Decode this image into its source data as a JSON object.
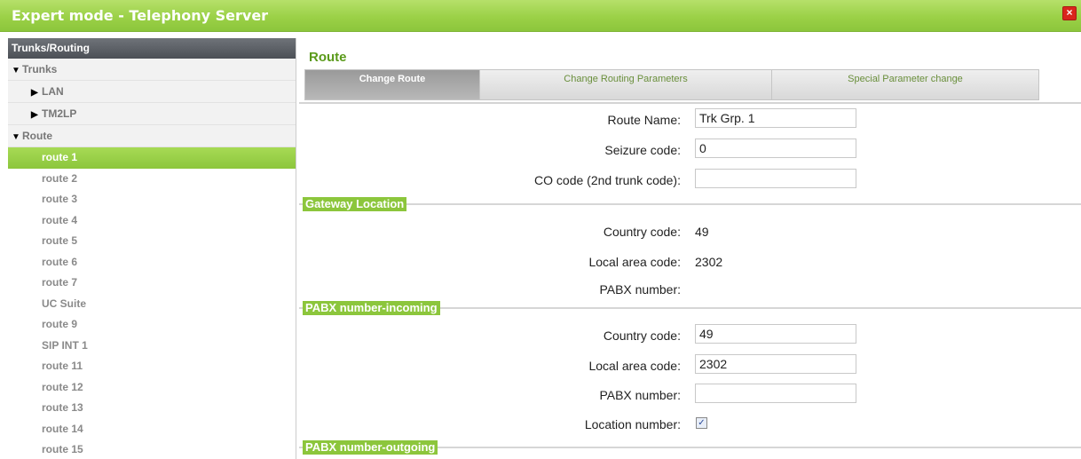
{
  "window": {
    "title": "Expert mode - Telephony Server",
    "close_icon": "close-icon"
  },
  "sidebar": {
    "header": "Trunks/Routing",
    "trunks_label": "Trunks",
    "lan_label": "LAN",
    "tm2lp_label": "TM2LP",
    "route_label": "Route",
    "routes": [
      "route 1",
      "route 2",
      "route 3",
      "route 4",
      "route 5",
      "route 6",
      "route 7",
      "UC Suite",
      "route 9",
      "SIP INT 1",
      "route 11",
      "route 12",
      "route 13",
      "route 14",
      "route 15"
    ],
    "active_route": "route 1"
  },
  "main": {
    "title": "Route",
    "tabs": [
      {
        "label": "Change Route",
        "active": true
      },
      {
        "label": "Change Routing Parameters",
        "active": false
      },
      {
        "label": "Special Parameter change",
        "active": false
      }
    ],
    "route_name_label": "Route Name:",
    "route_name_value": "Trk Grp. 1",
    "seizure_code_label": "Seizure code:",
    "seizure_code_value": "0",
    "co_code_label": "CO code (2nd trunk code):",
    "co_code_value": "",
    "gateway": {
      "title": "Gateway Location",
      "country_code_label": "Country code:",
      "country_code_value": "49",
      "local_area_code_label": "Local area code:",
      "local_area_code_value": "2302",
      "pabx_number_label": "PABX number:",
      "pabx_number_value": ""
    },
    "incoming": {
      "title": "PABX number-incoming",
      "country_code_label": "Country code:",
      "country_code_value": "49",
      "local_area_code_label": "Local area code:",
      "local_area_code_value": "2302",
      "pabx_number_label": "PABX number:",
      "pabx_number_value": "",
      "location_number_label": "Location number:",
      "location_number_checked": true
    },
    "outgoing": {
      "title": "PABX number-outgoing"
    }
  },
  "colors": {
    "accent": "#8cc63c",
    "header_dark": "#4c5056"
  }
}
